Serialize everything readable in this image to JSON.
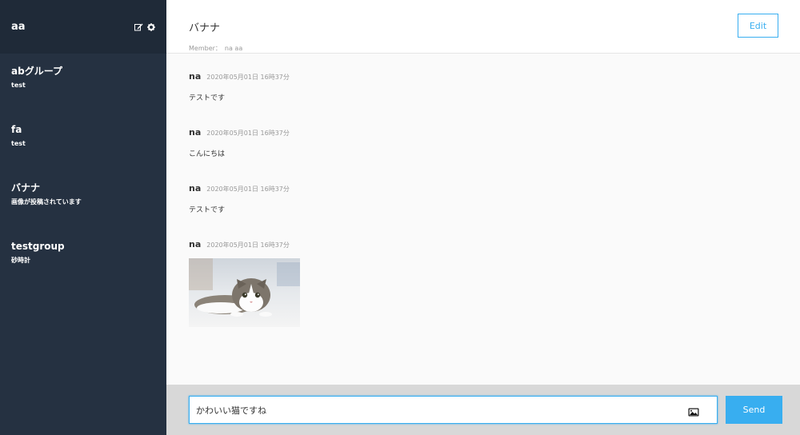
{
  "sidebar": {
    "user_name": "aa",
    "groups": [
      {
        "name": "abグループ",
        "last_message": "test"
      },
      {
        "name": "fa",
        "last_message": "test"
      },
      {
        "name": "バナナ",
        "last_message": "画像が投稿されています"
      },
      {
        "name": "testgroup",
        "last_message": "砂時計"
      }
    ]
  },
  "header": {
    "group_name": "バナナ",
    "members_label": "Member：",
    "members": "na aa",
    "edit_label": "Edit"
  },
  "messages": [
    {
      "user": "na",
      "date": "2020年05月01日 16時37分",
      "text": "テストです"
    },
    {
      "user": "na",
      "date": "2020年05月01日 16時37分",
      "text": "こんにちは"
    },
    {
      "user": "na",
      "date": "2020年05月01日 16時37分",
      "text": "テストです"
    },
    {
      "user": "na",
      "date": "2020年05月01日 16時37分"
    }
  ],
  "form": {
    "input_value": "かわいい猫ですね",
    "send_label": "Send"
  },
  "colors": {
    "sidebar_bg": "#253141",
    "sidebar_header_bg": "#1f2a38",
    "accent": "#38aef0"
  }
}
